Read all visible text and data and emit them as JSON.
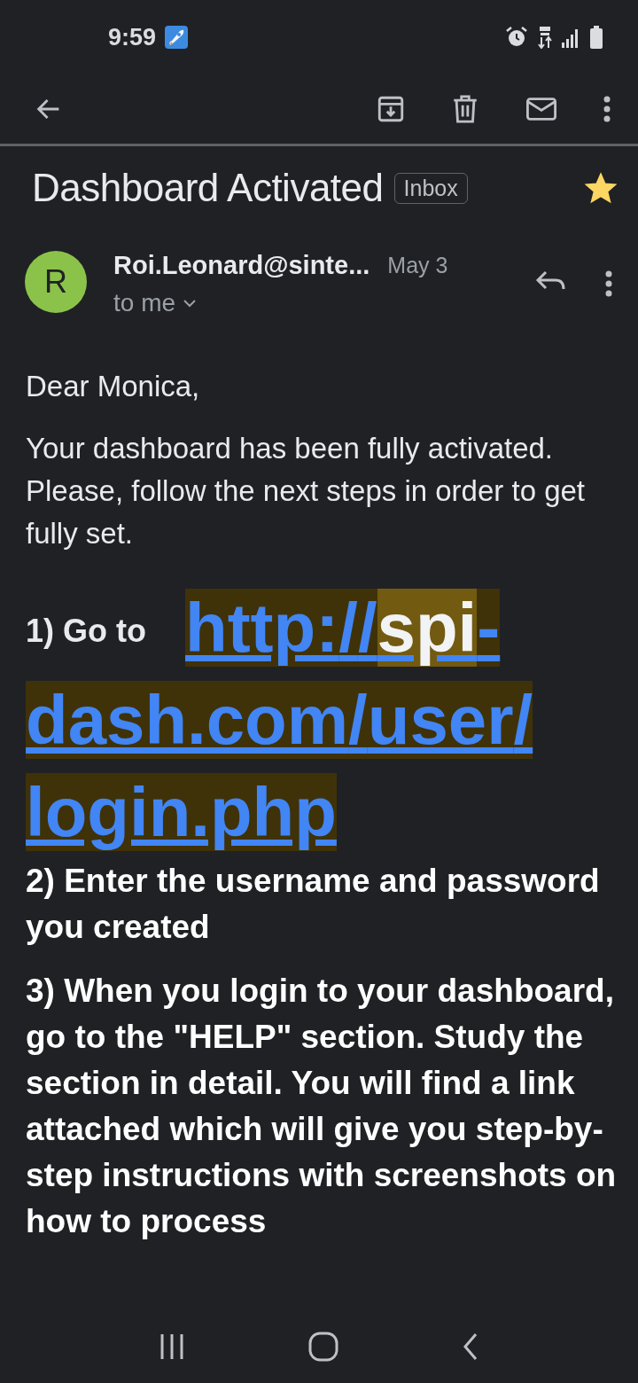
{
  "status_bar": {
    "time": "9:59"
  },
  "email": {
    "subject": "Dashboard Activated",
    "label": "Inbox",
    "starred": true,
    "sender": {
      "initial": "R",
      "name": "Roi.Leonard@sinte...",
      "date": "May 3",
      "recipient": "to me"
    },
    "greeting": "Dear Monica,",
    "intro": "Your dashboard has been fully activated. Please, follow the next steps in order to get fully set.",
    "step1_label": "1) Go to",
    "link_parts": [
      {
        "text": "http://",
        "current_match": false
      },
      {
        "text": "spi",
        "current_match": true
      },
      {
        "text": "-dash.com/user/login.php",
        "current_match": false
      }
    ],
    "steps": [
      "2) Enter the username and password you created",
      "3) When you login to your dashboard, go to the \"HELP\" section. Study the section in detail. You will find a link attached which will give you step-by-step instructions with screenshots on how to process"
    ]
  }
}
